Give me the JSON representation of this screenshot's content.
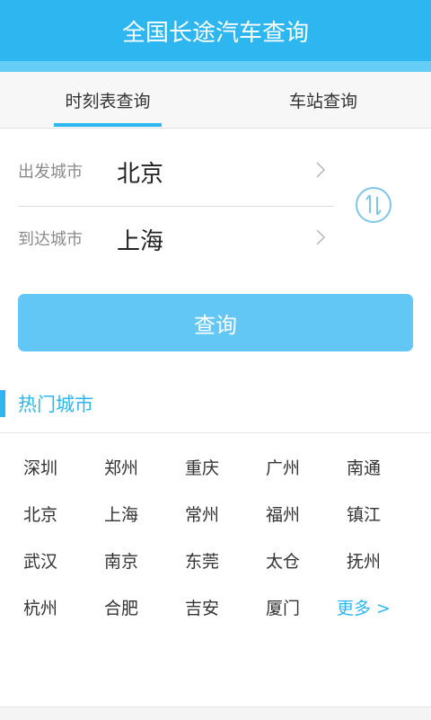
{
  "header": {
    "title": "全国长途汽车查询"
  },
  "tabs": [
    {
      "label": "时刻表查询",
      "active": true
    },
    {
      "label": "车站查询",
      "active": false
    }
  ],
  "form": {
    "from_label": "出发城市",
    "from_value": "北京",
    "to_label": "到达城市",
    "to_value": "上海"
  },
  "search_button": {
    "label": "查询"
  },
  "hot": {
    "title": "热门城市",
    "rows": [
      [
        "深圳",
        "郑州",
        "重庆",
        "广州",
        "南通"
      ],
      [
        "北京",
        "上海",
        "常州",
        "福州",
        "镇江"
      ],
      [
        "武汉",
        "南京",
        "东莞",
        "太仓",
        "抚州"
      ],
      [
        "杭州",
        "合肥",
        "吉安",
        "厦门",
        "更多 >"
      ]
    ]
  },
  "colors": {
    "accent": "#2eb6f1",
    "button": "#62c7f5",
    "swap_icon": "#7fc6e6"
  },
  "icons": {
    "swap": "swap-arrows-icon",
    "chevron": "chevron-right-icon"
  }
}
